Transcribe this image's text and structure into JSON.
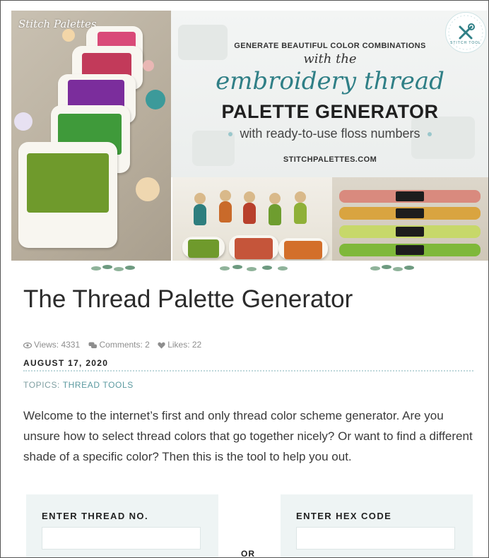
{
  "hero": {
    "brand": "Stitch Palettes",
    "banner_line1": "GENERATE BEAUTIFUL COLOR COMBINATIONS",
    "banner_line2": "with the",
    "banner_line3": "embroidery thread",
    "banner_line4": "PALETTE GENERATOR",
    "banner_line5": "with ready-to-use floss numbers",
    "banner_url": "STITCHPALETTES.COM",
    "badge_text": "STITCH TOOL",
    "colors": {
      "teal": "#2f7f86",
      "card": "#f8f6f0"
    }
  },
  "article": {
    "title": "The Thread Palette Generator",
    "views": "Views: 4331",
    "comments": "Comments: 2",
    "likes": "Likes: 22",
    "date": "AUGUST 17, 2020",
    "topics_label": "TOPICS:",
    "topic": "THREAD TOOLS",
    "intro": "Welcome to the internet’s first and only thread color scheme generator. Are you unsure how to select thread colors that go together nicely? Or want to find a different shade of a specific color? Then this is the tool to help you out."
  },
  "tool": {
    "thread_label": "ENTER THREAD NO.",
    "thread_value": "",
    "or_label": "OR",
    "hex_label": "ENTER HEX CODE",
    "hex_value": ""
  },
  "icons": [
    "eye-icon",
    "comments-icon",
    "heart-icon",
    "tools-icon"
  ]
}
